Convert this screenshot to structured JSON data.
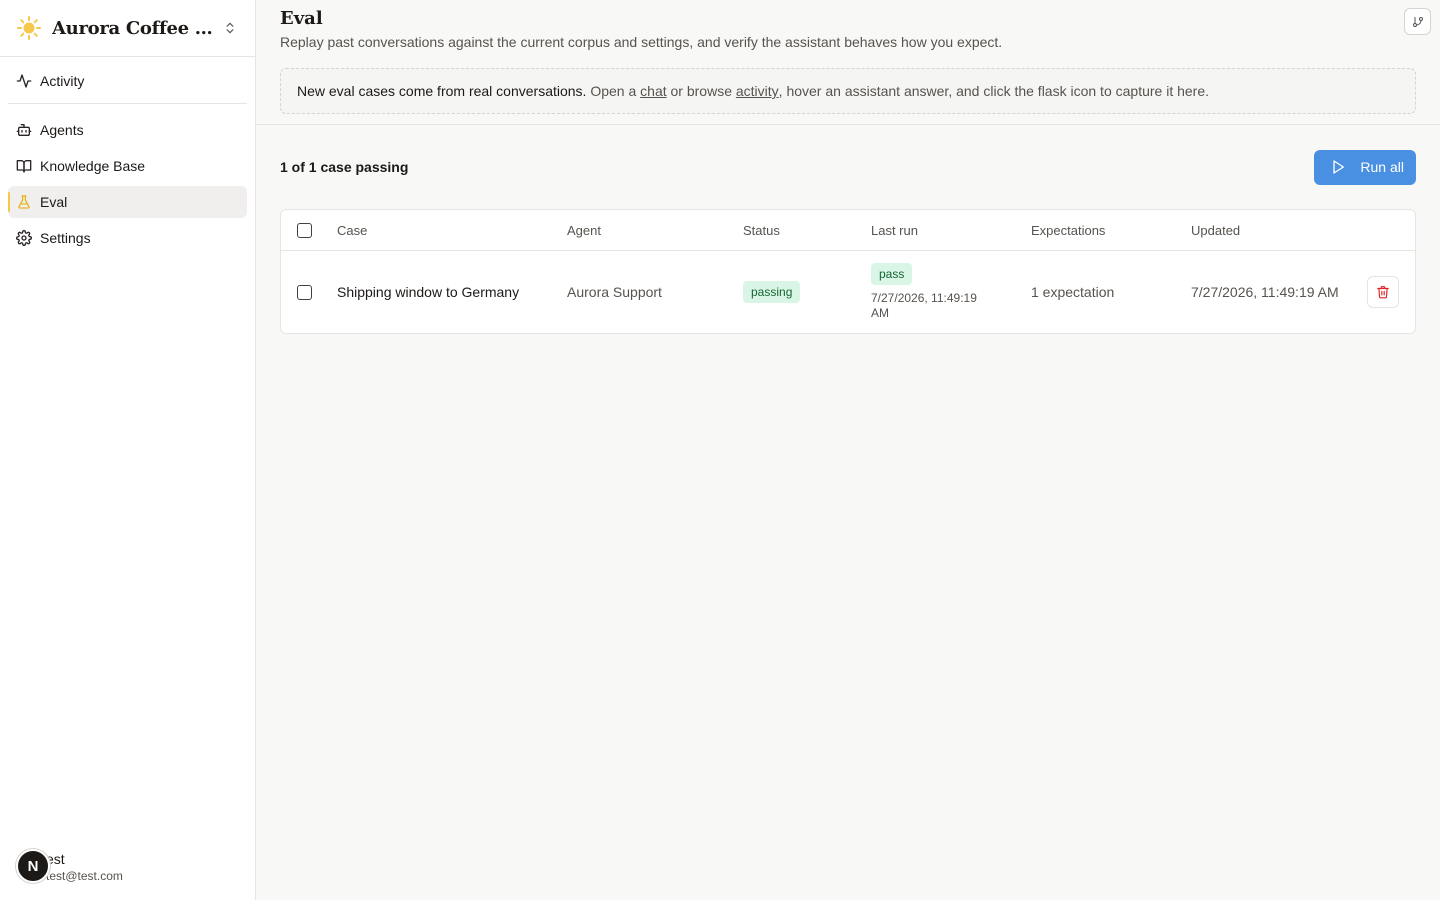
{
  "app": {
    "workspace_name": "Aurora Coffee R...",
    "brand_icon": "sun-icon",
    "brand_color": "#f5c84c"
  },
  "sidebar": {
    "items": [
      {
        "label": "Activity",
        "icon": "activity-icon"
      },
      {
        "label": "Agents",
        "icon": "bot-icon"
      },
      {
        "label": "Knowledge Base",
        "icon": "book-icon"
      },
      {
        "label": "Eval",
        "icon": "flask-icon",
        "active": true
      },
      {
        "label": "Settings",
        "icon": "gear-icon"
      }
    ]
  },
  "user": {
    "avatar_letter": "N",
    "name": "est",
    "email": "test@test.com"
  },
  "header": {
    "title": "Eval",
    "subtitle": "Replay past conversations against the current corpus and settings, and verify the assistant behaves how you expect."
  },
  "tip": {
    "lead": "New eval cases come from real conversations.",
    "part1": " Open a ",
    "chat_link": "chat",
    "part2": " or browse ",
    "activity_link": "activity",
    "part3": ", hover an assistant answer, and click the flask icon to capture it here."
  },
  "toolbar": {
    "summary": "1 of 1 case passing",
    "run_all_label": "Run all",
    "accent": "#4a90e2"
  },
  "table": {
    "columns": [
      "Case",
      "Agent",
      "Status",
      "Last run",
      "Expectations",
      "Updated"
    ],
    "rows": [
      {
        "case": "Shipping window to Germany",
        "agent": "Aurora Support",
        "status": "passing",
        "last_run_result": "pass",
        "last_run_time": "7/27/2026, 11:49:19 AM",
        "expectations": "1 expectation",
        "updated": "7/27/2026, 11:49:19 AM"
      }
    ]
  }
}
